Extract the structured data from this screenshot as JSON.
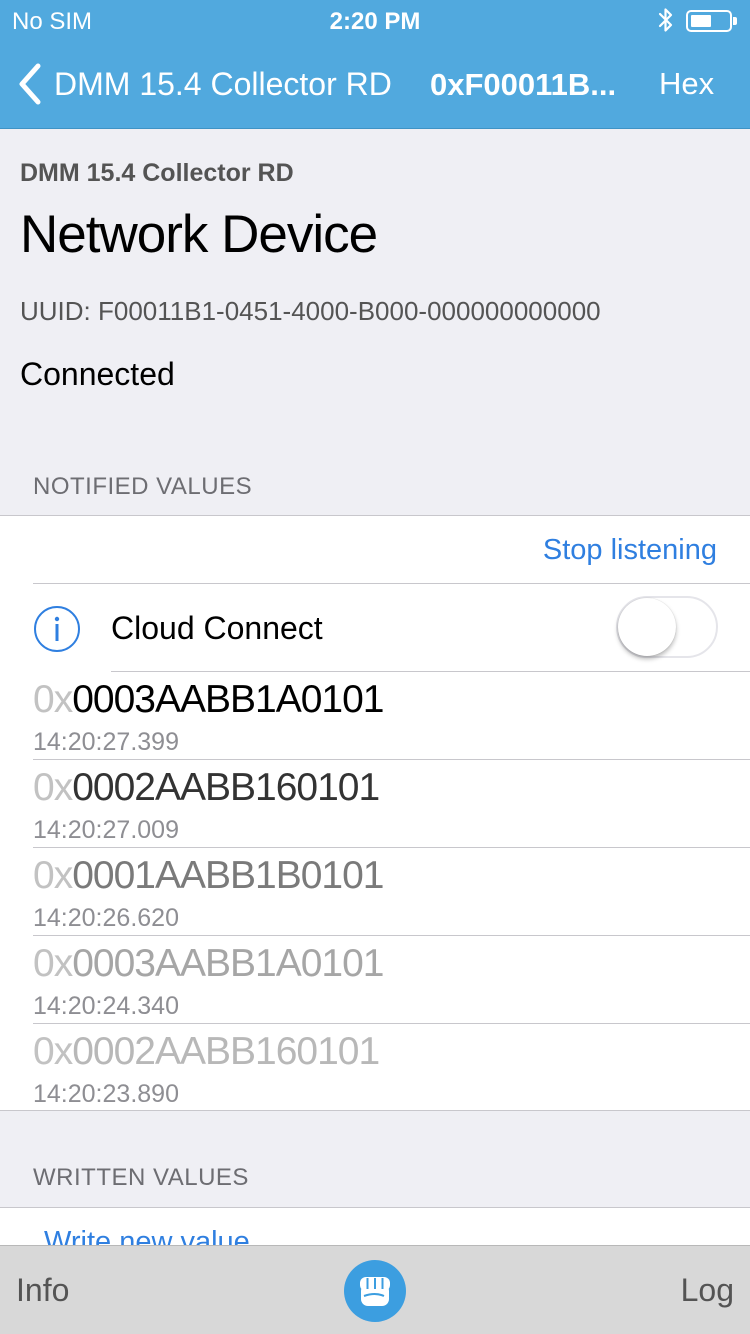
{
  "status_bar": {
    "carrier": "No SIM",
    "time": "2:20 PM"
  },
  "nav": {
    "back_label": "DMM 15.4 Collector RD",
    "title": "0xF00011B...",
    "format_button": "Hex"
  },
  "header": {
    "service_name": "DMM 15.4 Collector RD",
    "title": "Network Device",
    "uuid": "UUID: F00011B1-0451-4000-B000-000000000000",
    "connection_status": "Connected"
  },
  "notified": {
    "section_title": "NOTIFIED VALUES",
    "stop_label": "Stop listening",
    "cloud_label": "Cloud Connect",
    "cloud_enabled": false,
    "values": [
      {
        "prefix": "0x",
        "value": "0003AABB1A0101",
        "timestamp": "14:20:27.399",
        "color": "#000000"
      },
      {
        "prefix": "0x",
        "value": "0002AABB160101",
        "timestamp": "14:20:27.009",
        "color": "#333333"
      },
      {
        "prefix": "0x",
        "value": "0001AABB1B0101",
        "timestamp": "14:20:26.620",
        "color": "#7a7a7a"
      },
      {
        "prefix": "0x",
        "value": "0003AABB1A0101",
        "timestamp": "14:20:24.340",
        "color": "#a6a6a6"
      },
      {
        "prefix": "0x",
        "value": "0002AABB160101",
        "timestamp": "14:20:23.890",
        "color": "#b8b8b8"
      }
    ]
  },
  "written": {
    "section_title": "WRITTEN VALUES",
    "write_label": "Write new value"
  },
  "tab_bar": {
    "info_label": "Info",
    "log_label": "Log"
  },
  "colors": {
    "accent": "#51a9de",
    "link": "#2f7fe0",
    "tab_bar": "#d8d8d8"
  }
}
